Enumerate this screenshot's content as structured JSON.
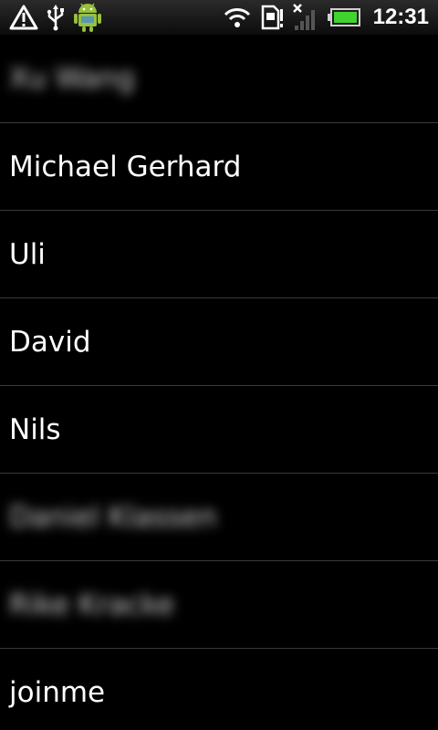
{
  "status_bar": {
    "time": "12:31",
    "icons": [
      "warning-icon",
      "usb-icon",
      "android-debug-icon",
      "wifi-icon",
      "sim-card-icon",
      "no-signal-icon",
      "battery-icon"
    ]
  },
  "contacts": [
    {
      "name": "Xu Wang",
      "blurred": true
    },
    {
      "name": "Michael Gerhard",
      "blurred": false
    },
    {
      "name": "Uli",
      "blurred": false
    },
    {
      "name": "David",
      "blurred": false
    },
    {
      "name": "Nils",
      "blurred": false
    },
    {
      "name": "Daniel Klassen",
      "blurred": true
    },
    {
      "name": "Rike Kracke",
      "blurred": true
    },
    {
      "name": "joinme",
      "blurred": false
    }
  ]
}
